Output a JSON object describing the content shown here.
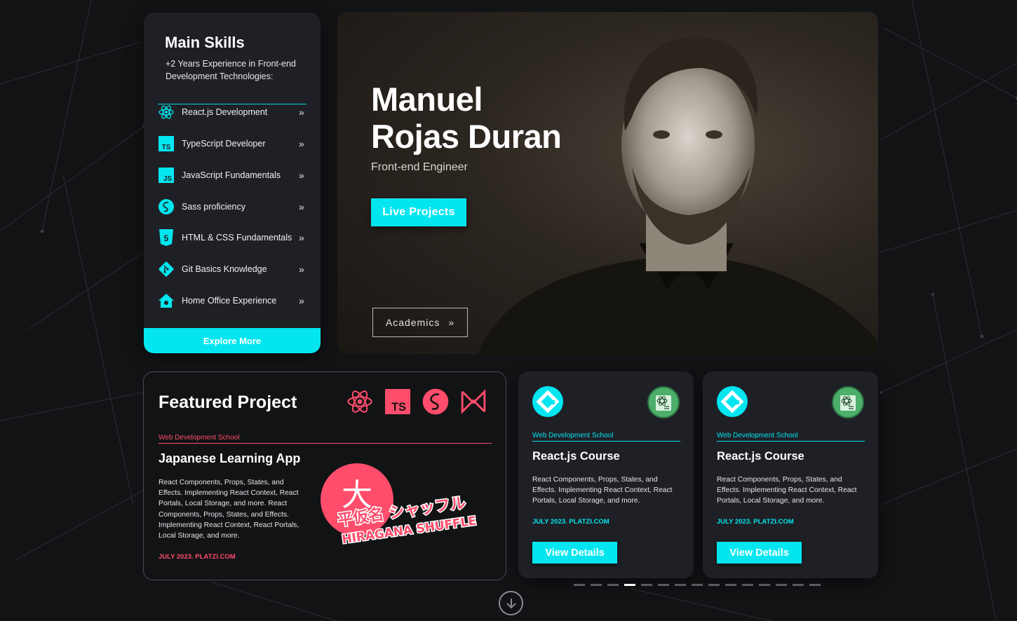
{
  "colors": {
    "accent": "#03e6f0",
    "featured_accent": "#ff4d6b",
    "panel": "#1f2026",
    "background": "#121315"
  },
  "skills": {
    "title": "Main Skills",
    "subtitle": "+2 Years Experience in Front-end Development Technologies:",
    "items": [
      {
        "label": "React.js Development",
        "icon": "react-icon"
      },
      {
        "label": "TypeScript Developer",
        "icon": "typescript-icon"
      },
      {
        "label": "JavaScript Fundamentals",
        "icon": "javascript-icon"
      },
      {
        "label": "Sass proficiency",
        "icon": "sass-icon"
      },
      {
        "label": "HTML & CSS Fundamentals",
        "icon": "html5-icon"
      },
      {
        "label": "Git Basics Knowledge",
        "icon": "git-icon"
      },
      {
        "label": "Home Office Experience",
        "icon": "home-icon"
      }
    ],
    "chevron": "»",
    "explore_label": "Explore More"
  },
  "hero": {
    "name_line1": "Manuel",
    "name_line2": "Rojas Duran",
    "role": "Front-end Engineer",
    "live_label": "Live Projects",
    "academics_label": "Academics",
    "academics_chevron": "»"
  },
  "featured": {
    "title": "Featured Project",
    "tech_icons": [
      "react-icon",
      "typescript-icon",
      "sass-icon",
      "maze-logo-icon"
    ],
    "school": "Web Development School",
    "project_title": "Japanese Learning App",
    "description": "React Components, Props, States, and Effects. Implementing React Context, React Portals, Local Storage, and more. React Components, Props, States, and Effects. Implementing React Context, React Portals, Local Storage, and more.",
    "date": "JULY 2023. PLATZI.COM",
    "logo_text_jp": "平仮名 シャッフル",
    "logo_text_en": "HIRAGANA SHUFFLE",
    "logo_glyph": "大"
  },
  "courses": [
    {
      "school": "Web Development School",
      "title": "React.js Course",
      "description": "React Components, Props, States, and Effects. Implementing React Context, React Portals, Local Storage, and more.",
      "date": "JULY 2023. PLATZI.COM",
      "button": "View Details"
    },
    {
      "school": "Web Development School",
      "title": "React.js Course",
      "description": "React Components, Props, States, and Effects. Implementing React Context, React Portals, Local Storage, and more.",
      "date": "JULY 2023. PLATZI.COM",
      "button": "View Details"
    }
  ],
  "pagination": {
    "total": 15,
    "active_index": 3
  }
}
